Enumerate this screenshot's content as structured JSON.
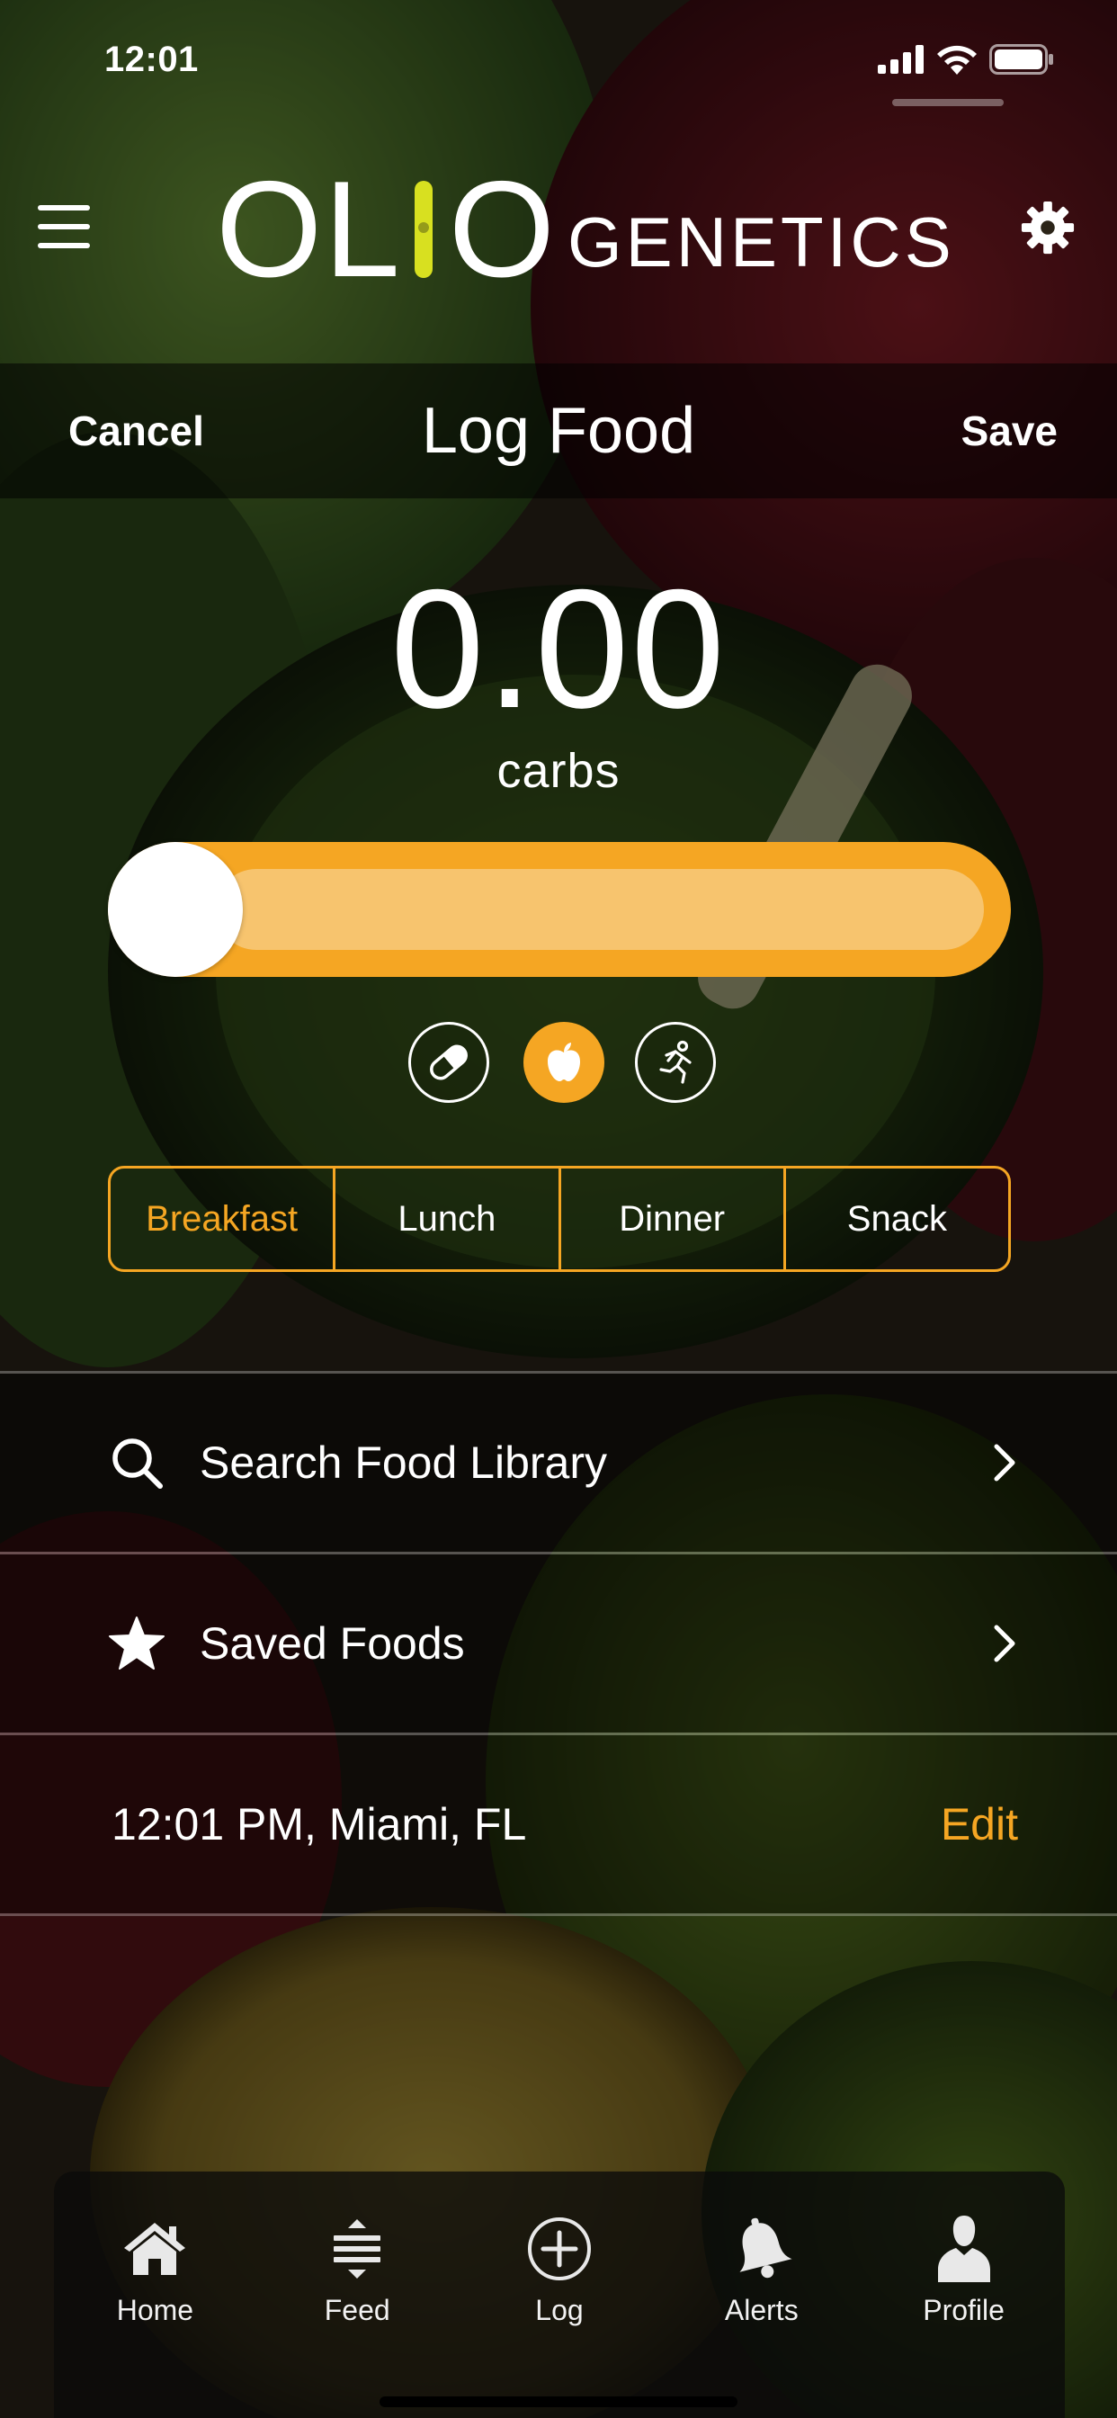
{
  "status_bar": {
    "time": "12:01"
  },
  "header": {
    "brand_primary": "OL",
    "brand_secondary": "O",
    "brand_suffix": "GENETICS"
  },
  "nav": {
    "cancel_label": "Cancel",
    "title": "Log Food",
    "save_label": "Save"
  },
  "entry": {
    "value": "0.00",
    "unit": "carbs",
    "slider_level": 0
  },
  "entry_types": [
    {
      "name": "medication",
      "icon": "pill-icon",
      "active": false
    },
    {
      "name": "food",
      "icon": "apple-icon",
      "active": true
    },
    {
      "name": "activity",
      "icon": "running-icon",
      "active": false
    }
  ],
  "meal_tabs": [
    {
      "label": "Breakfast",
      "active": true
    },
    {
      "label": "Lunch",
      "active": false
    },
    {
      "label": "Dinner",
      "active": false
    },
    {
      "label": "Snack",
      "active": false
    }
  ],
  "list": {
    "search_label": "Search Food Library",
    "saved_label": "Saved Foods",
    "time_location": "12:01 PM, Miami, FL",
    "edit_label": "Edit"
  },
  "tabbar": [
    {
      "label": "Home",
      "icon": "home-icon"
    },
    {
      "label": "Feed",
      "icon": "feed-icon"
    },
    {
      "label": "Log",
      "icon": "plus-circle-icon"
    },
    {
      "label": "Alerts",
      "icon": "bell-icon"
    },
    {
      "label": "Profile",
      "icon": "person-icon"
    }
  ],
  "colors": {
    "accent": "#f5a623",
    "accent_light": "#f7c46e",
    "brand_i": "#d8e020"
  }
}
